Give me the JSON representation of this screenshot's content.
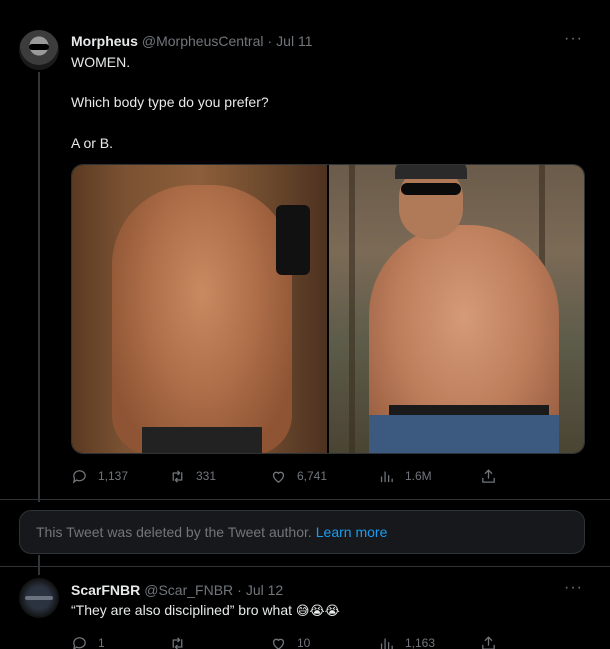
{
  "tweet1": {
    "display_name": "Morpheus",
    "handle": "@MorpheusCentral",
    "separator": "·",
    "date": "Jul 11",
    "more": "···",
    "lines": [
      "WOMEN.",
      "Which body type do you prefer?",
      "A or B."
    ],
    "media": {
      "image_a": "shirtless-fit-man-selfie",
      "image_b": "shirtless-bearded-man-outdoors"
    },
    "stats": {
      "replies": "1,137",
      "retweets": "331",
      "likes": "6,741",
      "views": "1.6M"
    }
  },
  "deleted_notice": {
    "text": "This Tweet was deleted by the Tweet author.",
    "link": "Learn more"
  },
  "tweet2": {
    "display_name": "ScarFNBR",
    "handle": "@Scar_FNBR",
    "separator": "·",
    "date": "Jul 12",
    "more": "···",
    "text": "“They are also disciplined” bro what",
    "emojis": "😅😭😭",
    "stats": {
      "replies": "1",
      "retweets": "",
      "likes": "10",
      "views": "1,163"
    }
  },
  "icons": {
    "reply": "reply-icon",
    "retweet": "retweet-icon",
    "like": "heart-icon",
    "views": "views-chart-icon",
    "share": "share-icon",
    "more": "more-dots-icon"
  },
  "colors": {
    "background": "#000000",
    "text": "#e7e9ea",
    "muted": "#71767b",
    "link": "#1d9bf0",
    "border": "#2f3336"
  }
}
